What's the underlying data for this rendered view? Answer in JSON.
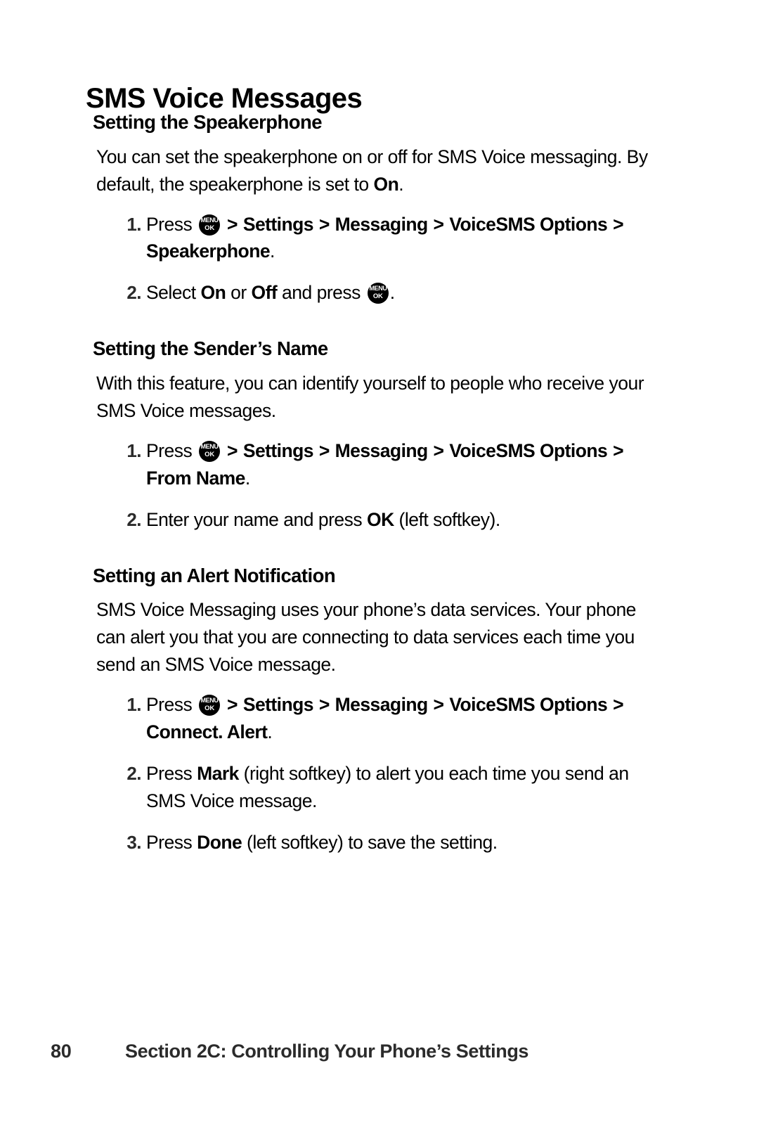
{
  "page": {
    "title": "SMS Voice Messages",
    "number": "80",
    "footer_text": "Section 2C: Controlling Your Phone’s Settings"
  },
  "icons": {
    "menu_key": {
      "name": "menu-ok-key-icon",
      "top_label": "MENU",
      "bottom_label": "OK"
    }
  },
  "sections": [
    {
      "heading": "Setting the Speakerphone",
      "body": {
        "lead": "You can set the speakerphone on or off for SMS Voice messaging. By default, the speakerphone is set to ",
        "bold": "On",
        "tail": "."
      },
      "steps": [
        {
          "num": "1.",
          "parts": [
            {
              "t": "Press ",
              "style": "normal"
            },
            {
              "t": "menu-key",
              "style": "icon"
            },
            {
              "t": " > ",
              "style": "chevron"
            },
            {
              "t": "Settings",
              "style": "bold"
            },
            {
              "t": " > ",
              "style": "chevron"
            },
            {
              "t": "Messaging",
              "style": "bold"
            },
            {
              "t": " > ",
              "style": "chevron"
            },
            {
              "t": "VoiceSMS Options",
              "style": "bold"
            },
            {
              "t": " > ",
              "style": "chevron"
            },
            {
              "t": "Speakerphone",
              "style": "bold"
            },
            {
              "t": ".",
              "style": "normal"
            }
          ]
        },
        {
          "num": "2.",
          "parts": [
            {
              "t": "Select ",
              "style": "normal"
            },
            {
              "t": "On",
              "style": "bold"
            },
            {
              "t": " or ",
              "style": "normal"
            },
            {
              "t": "Off",
              "style": "bold"
            },
            {
              "t": " and press ",
              "style": "normal"
            },
            {
              "t": "menu-key",
              "style": "icon"
            },
            {
              "t": ".",
              "style": "normal"
            }
          ]
        }
      ]
    },
    {
      "heading": "Setting the Sender’s Name",
      "body": {
        "lead": "With this feature, you can identify yourself to people who receive your SMS Voice messages.",
        "bold": "",
        "tail": ""
      },
      "steps": [
        {
          "num": "1.",
          "parts": [
            {
              "t": "Press ",
              "style": "normal"
            },
            {
              "t": "menu-key",
              "style": "icon"
            },
            {
              "t": " > ",
              "style": "chevron"
            },
            {
              "t": "Settings",
              "style": "bold"
            },
            {
              "t": " > ",
              "style": "chevron"
            },
            {
              "t": "Messaging",
              "style": "bold"
            },
            {
              "t": " > ",
              "style": "chevron"
            },
            {
              "t": "VoiceSMS Options",
              "style": "bold"
            },
            {
              "t": " > ",
              "style": "chevron"
            },
            {
              "t": "From Name",
              "style": "bold"
            },
            {
              "t": ".",
              "style": "normal"
            }
          ]
        },
        {
          "num": "2.",
          "parts": [
            {
              "t": "Enter your name and press ",
              "style": "normal"
            },
            {
              "t": "OK",
              "style": "bold"
            },
            {
              "t": " (left softkey).",
              "style": "normal"
            }
          ]
        }
      ]
    },
    {
      "heading": "Setting an Alert Notification",
      "body": {
        "lead": "SMS Voice Messaging uses your phone’s data services. Your phone can alert you that you are connecting to data services each time you send an SMS Voice message.",
        "bold": "",
        "tail": ""
      },
      "steps": [
        {
          "num": "1.",
          "parts": [
            {
              "t": "Press ",
              "style": "normal"
            },
            {
              "t": "menu-key",
              "style": "icon"
            },
            {
              "t": " > ",
              "style": "chevron"
            },
            {
              "t": "Settings",
              "style": "bold"
            },
            {
              "t": " > ",
              "style": "chevron"
            },
            {
              "t": "Messaging",
              "style": "bold"
            },
            {
              "t": " > ",
              "style": "chevron"
            },
            {
              "t": "VoiceSMS Options",
              "style": "bold"
            },
            {
              "t": " > ",
              "style": "chevron"
            },
            {
              "t": "Connect. Alert",
              "style": "bold"
            },
            {
              "t": ".",
              "style": "normal"
            }
          ]
        },
        {
          "num": "2.",
          "parts": [
            {
              "t": "Press ",
              "style": "normal"
            },
            {
              "t": "Mark",
              "style": "bold"
            },
            {
              "t": " (right softkey) to alert you each time you send an SMS Voice message.",
              "style": "normal"
            }
          ]
        },
        {
          "num": "3.",
          "parts": [
            {
              "t": "Press ",
              "style": "normal"
            },
            {
              "t": "Done",
              "style": "bold"
            },
            {
              "t": " (left softkey) to save the setting.",
              "style": "normal"
            }
          ]
        }
      ]
    }
  ]
}
